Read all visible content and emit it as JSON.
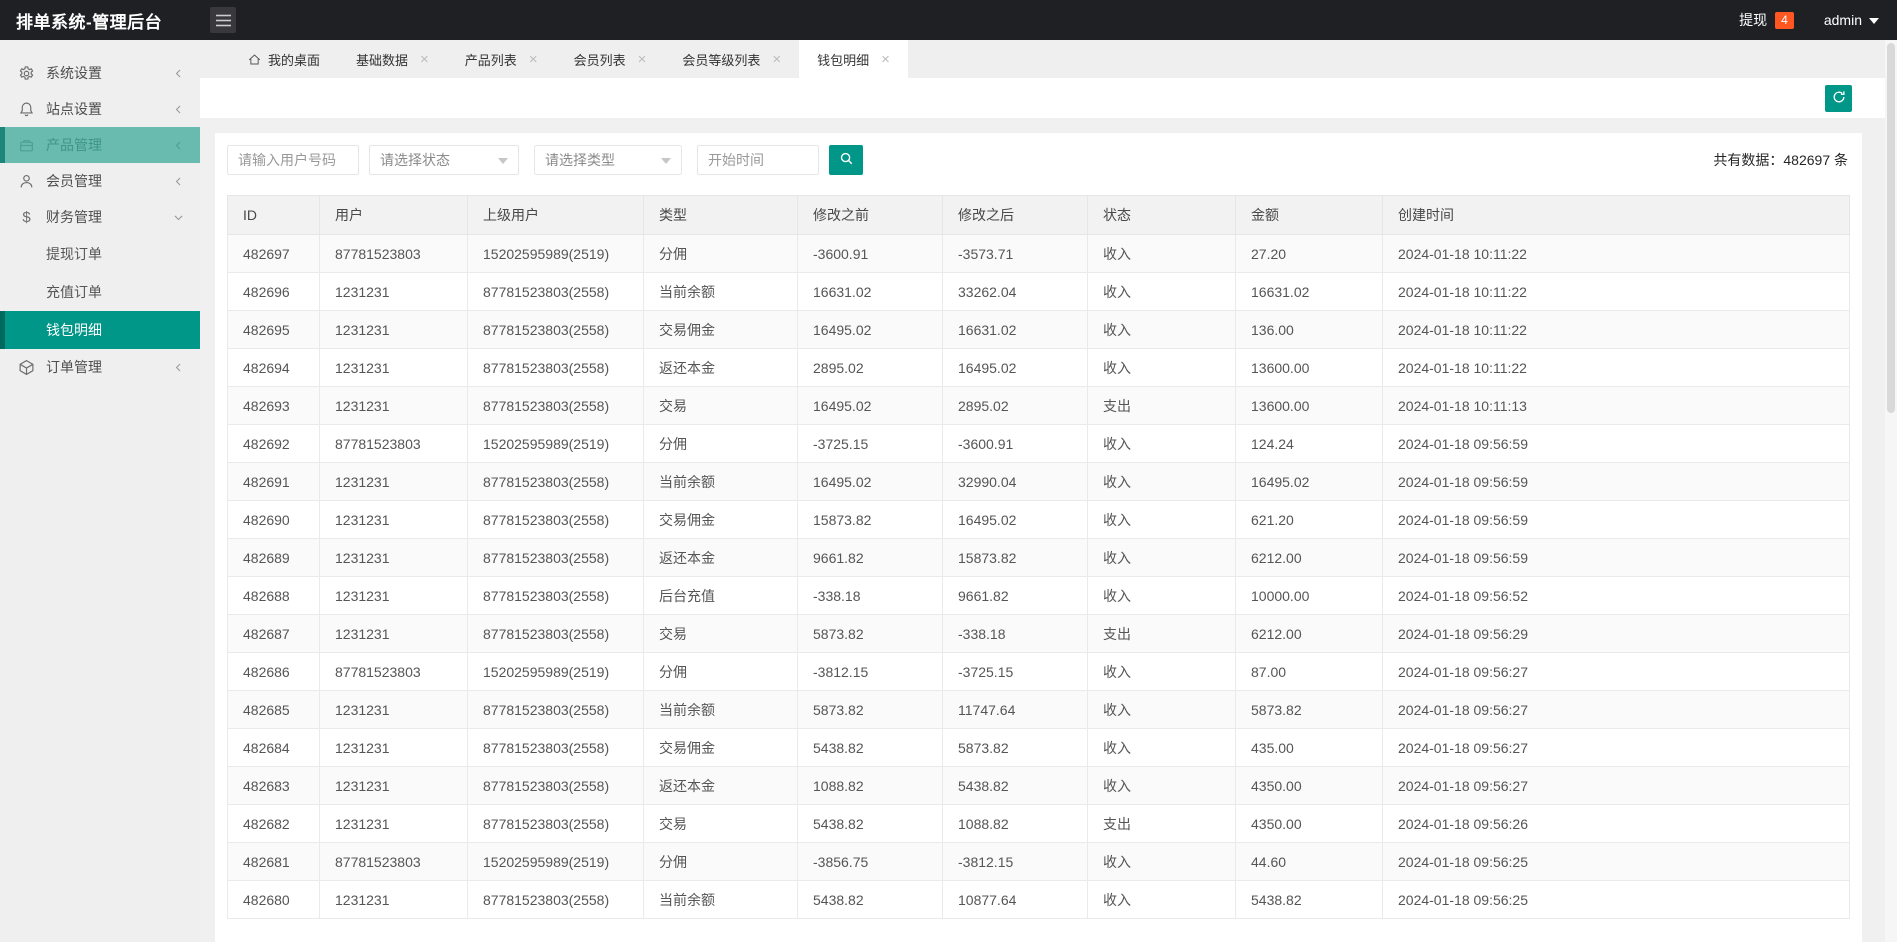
{
  "header": {
    "title": "排单系统-管理后台",
    "withdraw_label": "提现",
    "withdraw_count": "4",
    "username": "admin"
  },
  "sidebar": {
    "items": [
      {
        "label": "系统设置",
        "icon": "gear-icon"
      },
      {
        "label": "站点设置",
        "icon": "bell-icon"
      },
      {
        "label": "产品管理",
        "icon": "package-icon"
      },
      {
        "label": "会员管理",
        "icon": "user-icon"
      },
      {
        "label": "财务管理",
        "icon": "dollar-icon"
      },
      {
        "label": "订单管理",
        "icon": "cube-icon"
      }
    ],
    "finance_children": [
      {
        "label": "提现订单"
      },
      {
        "label": "充值订单"
      },
      {
        "label": "钱包明细"
      }
    ]
  },
  "tabs": [
    {
      "label": "我的桌面",
      "closable": false
    },
    {
      "label": "基础数据",
      "closable": true
    },
    {
      "label": "产品列表",
      "closable": true
    },
    {
      "label": "会员列表",
      "closable": true
    },
    {
      "label": "会员等级列表",
      "closable": true
    },
    {
      "label": "钱包明细",
      "closable": true,
      "active": true
    }
  ],
  "filters": {
    "user_placeholder": "请输入用户号码",
    "status_placeholder": "请选择状态",
    "type_placeholder": "请选择类型",
    "time_placeholder": "开始时间"
  },
  "summary": {
    "label": "共有数据：",
    "count": "482697",
    "unit": "条"
  },
  "accent_colors": {
    "teal": "#009688",
    "badge_red": "#ff5722"
  },
  "table": {
    "columns": [
      "ID",
      "用户",
      "上级用户",
      "类型",
      "修改之前",
      "修改之后",
      "状态",
      "金额",
      "创建时间"
    ],
    "rows": [
      [
        "482697",
        "87781523803",
        "15202595989(2519)",
        "分佣",
        "-3600.91",
        "-3573.71",
        "收入",
        "27.20",
        "2024-01-18 10:11:22"
      ],
      [
        "482696",
        "1231231",
        "87781523803(2558)",
        "当前余额",
        "16631.02",
        "33262.04",
        "收入",
        "16631.02",
        "2024-01-18 10:11:22"
      ],
      [
        "482695",
        "1231231",
        "87781523803(2558)",
        "交易佣金",
        "16495.02",
        "16631.02",
        "收入",
        "136.00",
        "2024-01-18 10:11:22"
      ],
      [
        "482694",
        "1231231",
        "87781523803(2558)",
        "返还本金",
        "2895.02",
        "16495.02",
        "收入",
        "13600.00",
        "2024-01-18 10:11:22"
      ],
      [
        "482693",
        "1231231",
        "87781523803(2558)",
        "交易",
        "16495.02",
        "2895.02",
        "支出",
        "13600.00",
        "2024-01-18 10:11:13"
      ],
      [
        "482692",
        "87781523803",
        "15202595989(2519)",
        "分佣",
        "-3725.15",
        "-3600.91",
        "收入",
        "124.24",
        "2024-01-18 09:56:59"
      ],
      [
        "482691",
        "1231231",
        "87781523803(2558)",
        "当前余额",
        "16495.02",
        "32990.04",
        "收入",
        "16495.02",
        "2024-01-18 09:56:59"
      ],
      [
        "482690",
        "1231231",
        "87781523803(2558)",
        "交易佣金",
        "15873.82",
        "16495.02",
        "收入",
        "621.20",
        "2024-01-18 09:56:59"
      ],
      [
        "482689",
        "1231231",
        "87781523803(2558)",
        "返还本金",
        "9661.82",
        "15873.82",
        "收入",
        "6212.00",
        "2024-01-18 09:56:59"
      ],
      [
        "482688",
        "1231231",
        "87781523803(2558)",
        "后台充值",
        "-338.18",
        "9661.82",
        "收入",
        "10000.00",
        "2024-01-18 09:56:52"
      ],
      [
        "482687",
        "1231231",
        "87781523803(2558)",
        "交易",
        "5873.82",
        "-338.18",
        "支出",
        "6212.00",
        "2024-01-18 09:56:29"
      ],
      [
        "482686",
        "87781523803",
        "15202595989(2519)",
        "分佣",
        "-3812.15",
        "-3725.15",
        "收入",
        "87.00",
        "2024-01-18 09:56:27"
      ],
      [
        "482685",
        "1231231",
        "87781523803(2558)",
        "当前余额",
        "5873.82",
        "11747.64",
        "收入",
        "5873.82",
        "2024-01-18 09:56:27"
      ],
      [
        "482684",
        "1231231",
        "87781523803(2558)",
        "交易佣金",
        "5438.82",
        "5873.82",
        "收入",
        "435.00",
        "2024-01-18 09:56:27"
      ],
      [
        "482683",
        "1231231",
        "87781523803(2558)",
        "返还本金",
        "1088.82",
        "5438.82",
        "收入",
        "4350.00",
        "2024-01-18 09:56:27"
      ],
      [
        "482682",
        "1231231",
        "87781523803(2558)",
        "交易",
        "5438.82",
        "1088.82",
        "支出",
        "4350.00",
        "2024-01-18 09:56:26"
      ],
      [
        "482681",
        "87781523803",
        "15202595989(2519)",
        "分佣",
        "-3856.75",
        "-3812.15",
        "收入",
        "44.60",
        "2024-01-18 09:56:25"
      ],
      [
        "482680",
        "1231231",
        "87781523803(2558)",
        "当前余额",
        "5438.82",
        "10877.64",
        "收入",
        "5438.82",
        "2024-01-18 09:56:25"
      ]
    ]
  }
}
